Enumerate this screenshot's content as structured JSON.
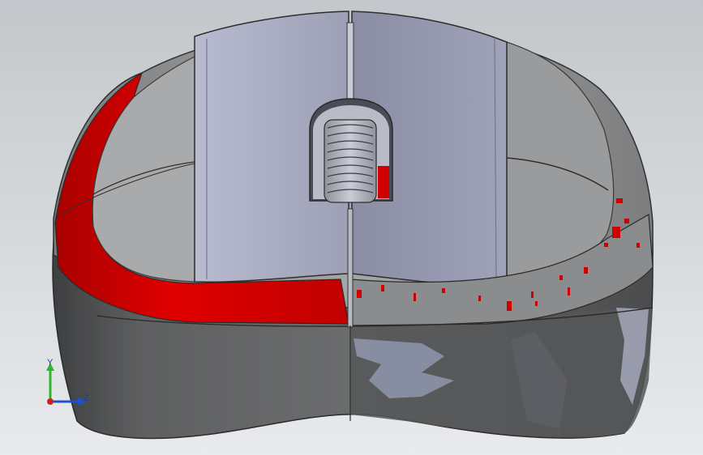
{
  "viewport": {
    "model": "computer-mouse-shell",
    "view": "front",
    "colors": {
      "background_top": "#c3c7cb",
      "background_bottom": "#e8eaec",
      "shell_dark": "#5a5b5c",
      "shell_mid": "#8e8f90",
      "button_face": "#9ea1b6",
      "section_red": "#d10000",
      "wheel": "#a8abb3"
    }
  },
  "triad": {
    "y_label": "Y",
    "z_label": "Z",
    "y_color": "#2db52d",
    "z_color": "#2050d0",
    "x_color": "#d02020"
  }
}
